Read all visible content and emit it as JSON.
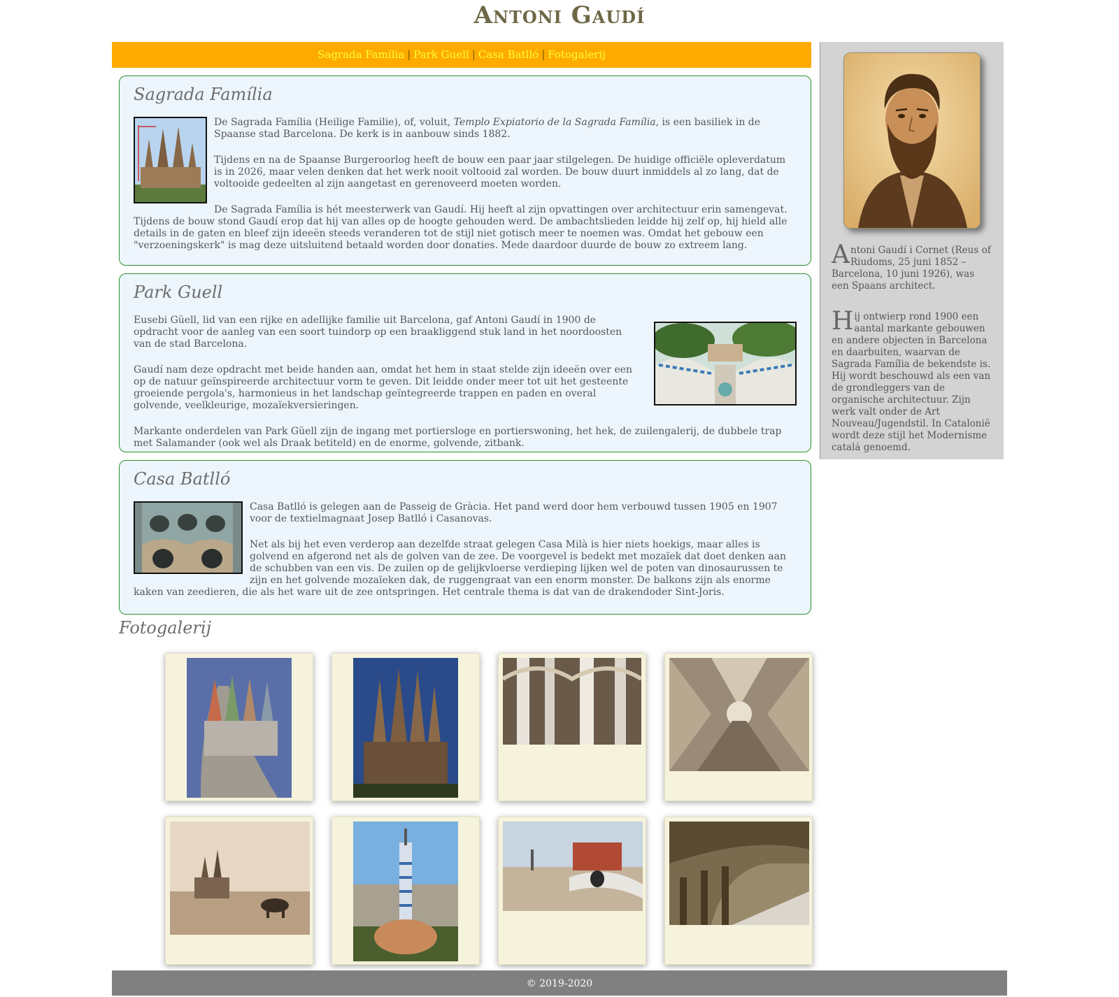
{
  "site": {
    "title": "Antoni Gaudí"
  },
  "nav": {
    "items": [
      {
        "label": "Sagrada Família"
      },
      {
        "label": "Park Guell"
      },
      {
        "label": "Casa Batlló"
      },
      {
        "label": "Fotogalerij"
      }
    ],
    "separator": "|"
  },
  "sections": {
    "sagrada": {
      "title": "Sagrada Família",
      "p1_before": "De Sagrada Família (Heilige Familie), of, voluit, ",
      "p1_italic": "Templo Expiatorio de la Sagrada Família",
      "p1_after": ", is een basiliek in de Spaanse stad Barcelona. De kerk is in aanbouw sinds 1882.",
      "p2": "Tijdens en na de Spaanse Burgeroorlog heeft de bouw een paar jaar stilgelegen. De huidige officiële opleverdatum is in 2026, maar velen denken dat het werk nooit voltooid zal worden. De bouw duurt inmiddels al zo lang, dat de voltooide gedeelten al zijn aangetast en gerenoveerd moeten worden.",
      "p3": "De Sagrada Família is hét meesterwerk van Gaudí. Hij heeft al zijn opvattingen over architectuur erin samengevat. Tijdens de bouw stond Gaudí erop dat hij van alles op de hoogte gehouden werd. De ambachtslieden leidde hij zelf op, hij hield alle details in de gaten en bleef zijn ideeën steeds veranderen tot de stijl niet gotisch meer te noemen was. Omdat het gebouw een \"verzoeningskerk\" is mag deze uitsluitend betaald worden door donaties. Mede daardoor duurde de bouw zo extreem lang."
    },
    "park": {
      "title": "Park Guell",
      "p1": "Eusebi Güell, lid van een rijke en adellijke familie uit Barcelona, gaf Antoni Gaudí in 1900 de opdracht voor de aanleg van een soort tuindorp op een braakliggend stuk land in het noordoosten van de stad Barcelona.",
      "p2": "Gaudí nam deze opdracht met beide handen aan, omdat het hem in staat stelde zijn ideeën over een op de natuur geïnspireerde architectuur vorm te geven. Dit leidde onder meer tot uit het gesteente groeiende pergola's, harmonieus in het landschap geïntegreerde trappen en paden en overal golvende, veelkleurige, mozaïekversieringen.",
      "p3": "Markante onderdelen van Park Güell zijn de ingang met portiersloge en portierswoning, het hek, de zuilengalerij, de dubbele trap met Salamander (ook wel als Draak betiteld) en de enorme, golvende, zitbank."
    },
    "batllo": {
      "title": "Casa Batlló",
      "p1": "Casa Batlló is gelegen aan de Passeig de Gràcia. Het pand werd door hem verbouwd tussen 1905 en 1907 voor de textielmagnaat Josep Batlló i Casanovas.",
      "p2": "Net als bij het even verderop aan dezelfde straat gelegen Casa Milà is hier niets hoekigs, maar alles is golvend en afgerond net als de golven van de zee. De voorgevel is bedekt met mozaïek dat doet denken aan de schubben van een vis. De zuilen op de gelijkvloerse verdieping lijken wel de poten van dinosaurussen te zijn en het golvende mozaïeken dak, de ruggengraat van een enorm monster. De balkons zijn als enorme kaken van zeedieren, die als het ware uit de zee ontspringen. Het centrale thema is dat van de drakendoder Sint-Joris."
    }
  },
  "sidebar": {
    "p1": "Antoni Gaudí i Cornet (Reus of Riudoms, 25 juni 1852 – Barcelona, 10 juni 1926), was een Spaans architect.",
    "p2": "Hij ontwierp rond 1900 een aantal markante gebouwen en andere objecten in Barcelona en daarbuiten, waarvan de Sagrada Família de bekendste is. Hij wordt beschouwd als een van de grondleggers van de organische architectuur. Zijn werk valt onder de Art Nouveau/Jugendstil. In Catalonië wordt deze stijl het Modernisme catalá genoemd."
  },
  "gallery": {
    "title": "Fotogalerij"
  },
  "footer": {
    "text": "© 2019-2020"
  },
  "colors": {
    "nav_bg": "#ffaa00",
    "nav_link": "#ffff33",
    "section_bg": "#eef6fd",
    "section_border": "#2f8f2f",
    "sidebar_bg": "#d3d3d3",
    "card_bg": "#f5f3dc",
    "footer_bg": "#808080"
  }
}
